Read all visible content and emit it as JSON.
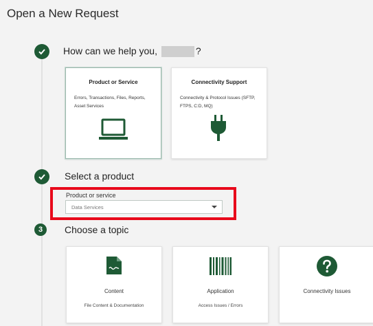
{
  "page": {
    "title": "Open a New Request"
  },
  "steps": [
    {
      "status": "complete",
      "title_prefix": "How can we help you,",
      "title_suffix": "?"
    },
    {
      "status": "complete",
      "title": "Select a product"
    },
    {
      "status": "current",
      "number": "3",
      "title": "Choose a topic"
    }
  ],
  "help_cards": [
    {
      "title": "Product or Service",
      "description": "Errors, Transactions, Files, Reports, Asset Services",
      "icon": "laptop-icon",
      "selected": true
    },
    {
      "title": "Connectivity Support",
      "description": "Connectivity & Protocol Issues (SFTP, FTPS, C:D, MQ)",
      "icon": "plug-icon",
      "selected": false
    }
  ],
  "product_select": {
    "label": "Product or service",
    "value": "Data Services"
  },
  "topic_cards": [
    {
      "title": "Content",
      "description": "File Content & Documentation",
      "icon": "document-icon"
    },
    {
      "title": "Application",
      "description": "Access Issues / Errors",
      "icon": "barcode-icon"
    },
    {
      "title": "Connectivity Issues",
      "description": "",
      "icon": "question-icon"
    }
  ],
  "colors": {
    "brand": "#1e5a35",
    "highlight": "#e8091b",
    "background": "#f3f3f3"
  }
}
